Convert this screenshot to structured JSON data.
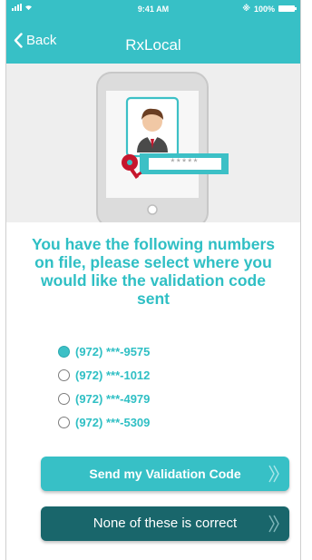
{
  "status_bar": {
    "time": "9:41 AM",
    "battery": "100%"
  },
  "nav": {
    "back_label": "Back",
    "title": "RxLocal"
  },
  "illustration": {
    "masked_code": "*****"
  },
  "prompt": "You have the following numbers on file, please select where you would like the validation code sent",
  "phone_options": [
    {
      "label": "(972) ***-9575",
      "selected": true
    },
    {
      "label": "(972) ***-1012",
      "selected": false
    },
    {
      "label": "(972) ***-4979",
      "selected": false
    },
    {
      "label": "(972) ***-5309",
      "selected": false
    }
  ],
  "buttons": {
    "send": "Send my Validation Code",
    "none": "None of these is correct"
  },
  "colors": {
    "accent": "#37c0c6",
    "dark_accent": "#19666b",
    "text_accent": "#2fbfc4",
    "key_red": "#c6162d"
  }
}
